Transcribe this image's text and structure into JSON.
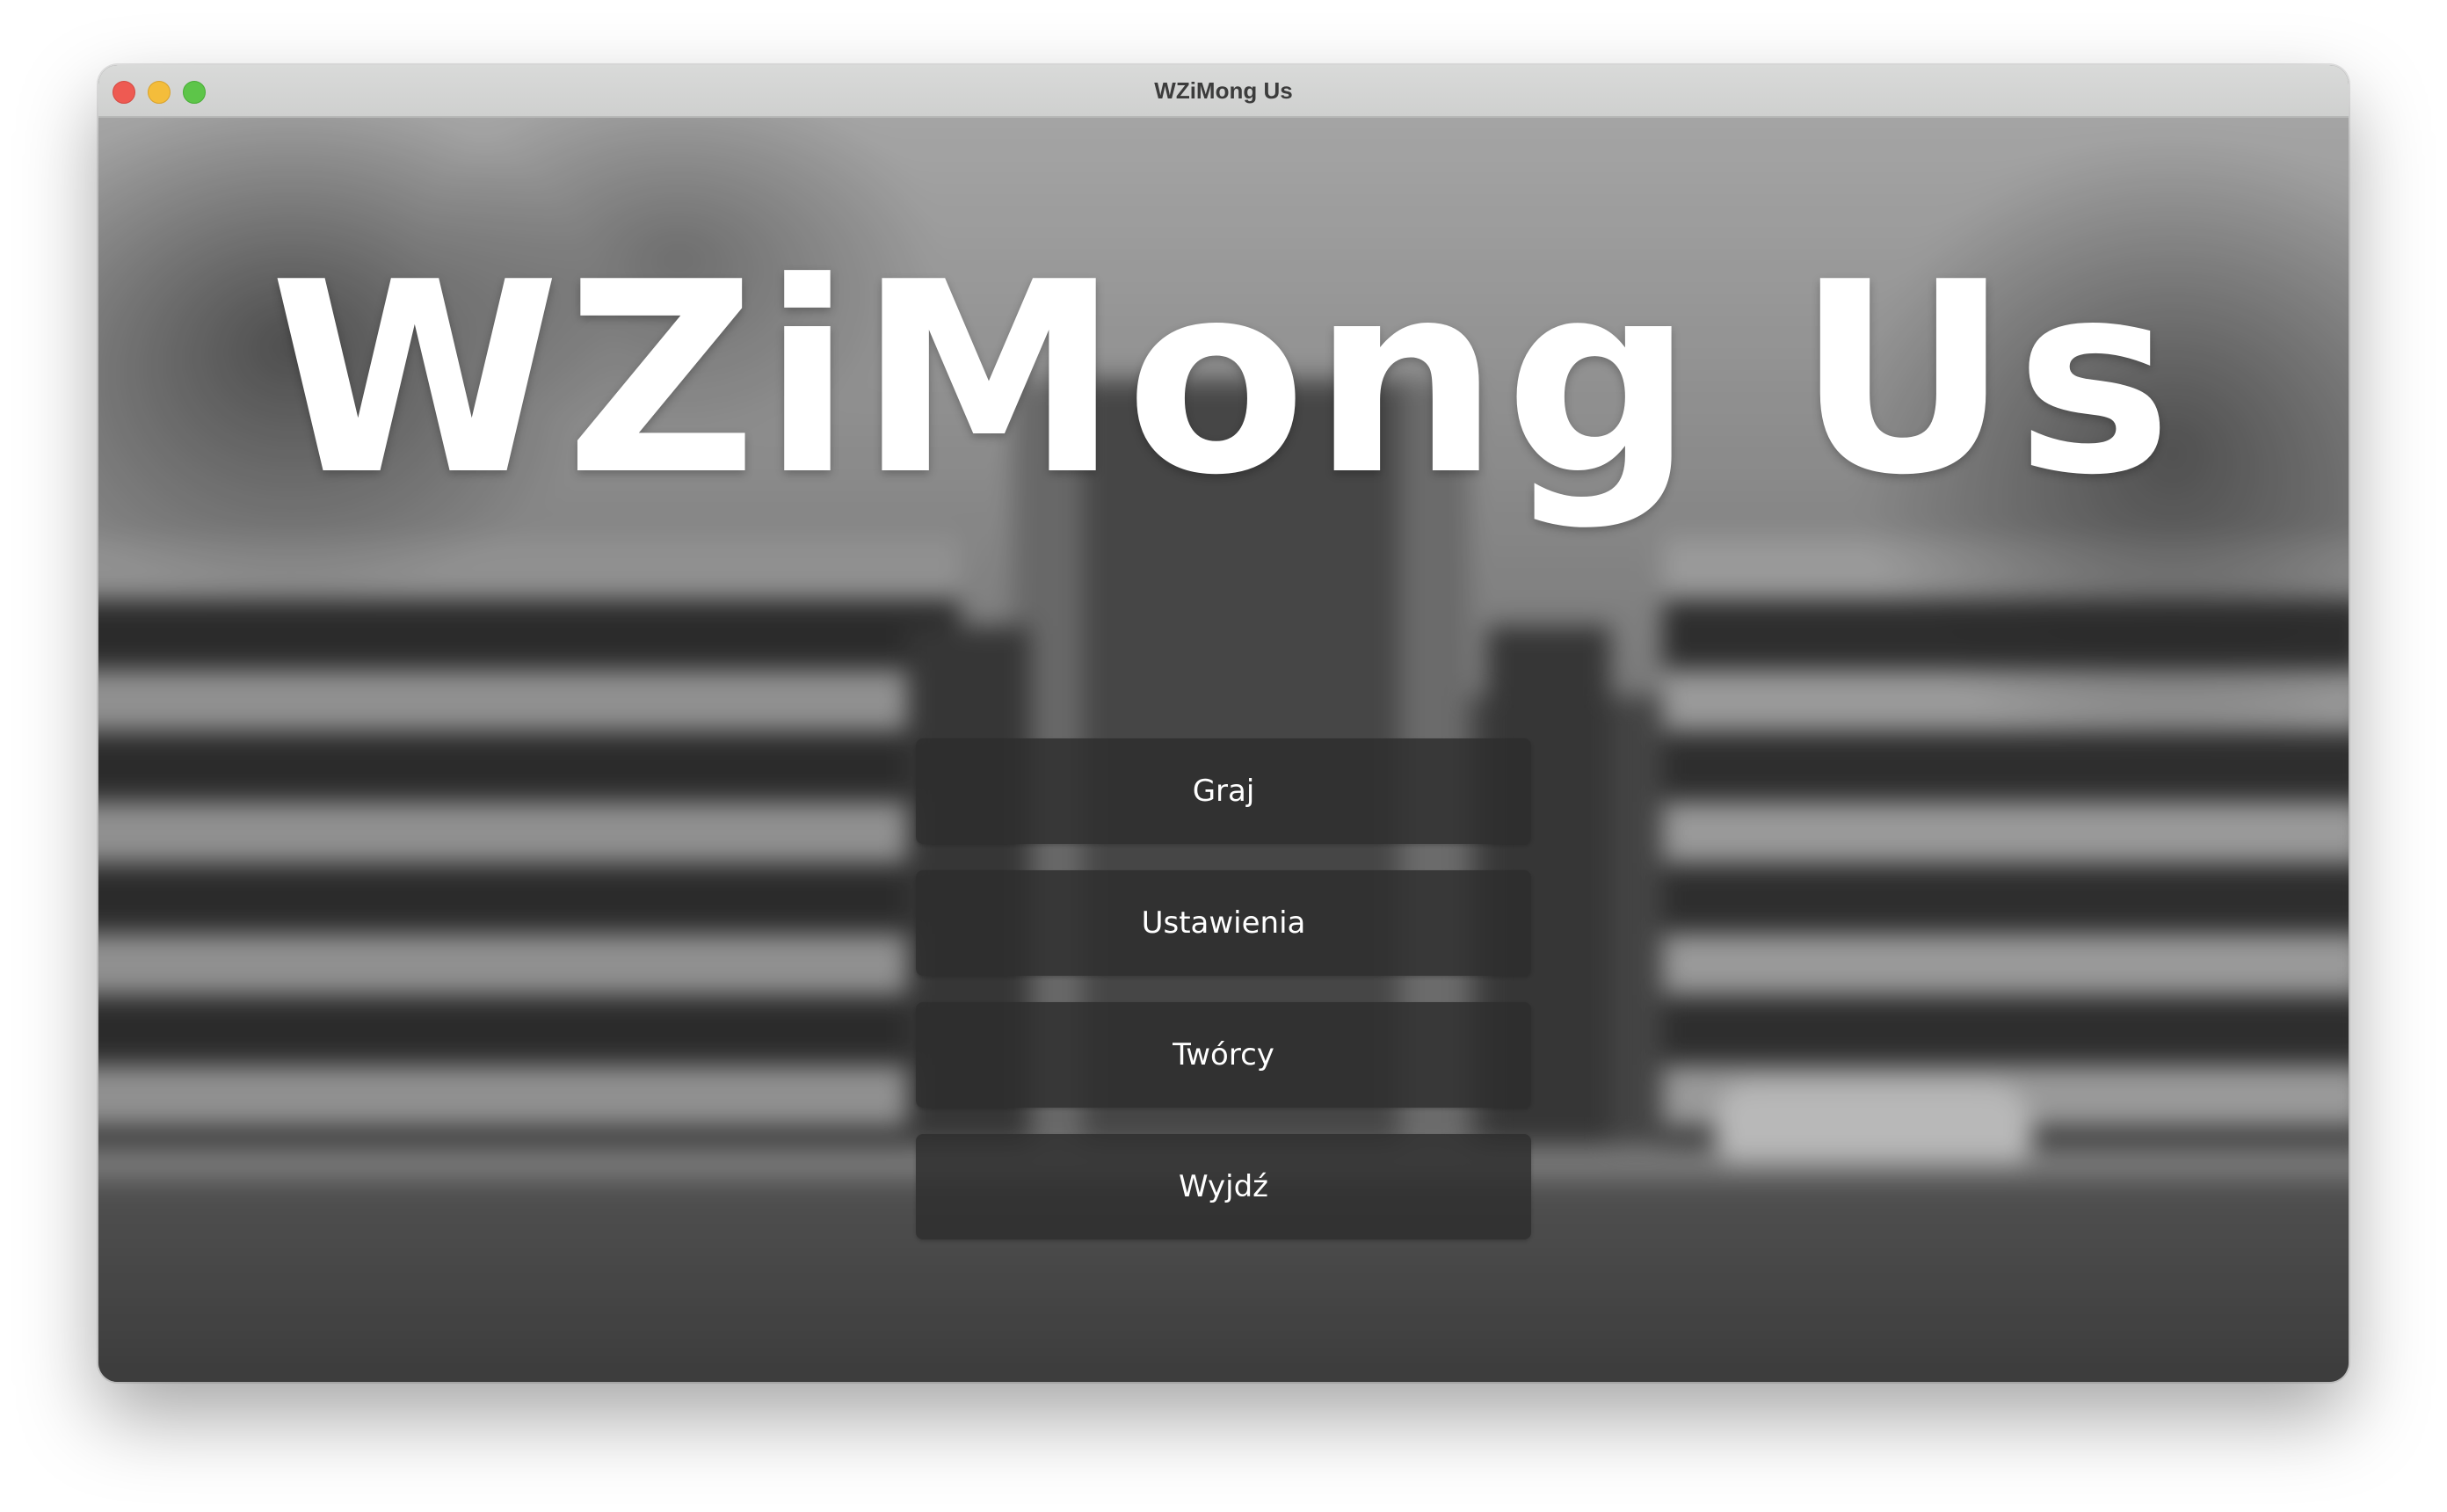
{
  "window": {
    "title": "WZiMong Us"
  },
  "game": {
    "title": "WZiMong Us"
  },
  "menu": {
    "items": [
      {
        "label": "Graj"
      },
      {
        "label": "Ustawienia"
      },
      {
        "label": "Twórcy"
      },
      {
        "label": "Wyjdź"
      }
    ]
  },
  "colors": {
    "button_background": "#2d2d2d",
    "title_text": "#ffffff",
    "close": "#ee5a52",
    "minimize": "#f4bd3b",
    "maximize": "#5dc549"
  }
}
